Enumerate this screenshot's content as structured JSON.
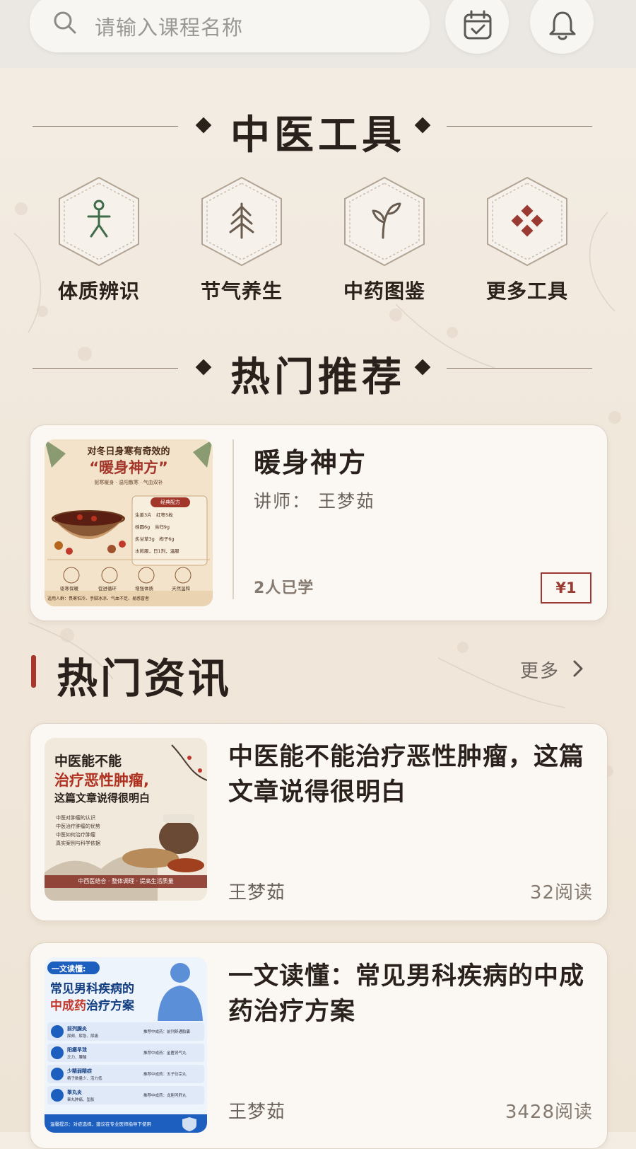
{
  "search": {
    "placeholder": "请输入课程名称",
    "icon": "search-icon"
  },
  "header_actions": [
    {
      "name": "calendar-icon"
    },
    {
      "name": "bell-icon"
    }
  ],
  "tools_section": {
    "title": "中医工具",
    "items": [
      {
        "label": "体质辨识",
        "icon": "person-icon",
        "color": "#3f6b4b"
      },
      {
        "label": "节气养生",
        "icon": "tree-icon",
        "color": "#6a5c4f"
      },
      {
        "label": "中药图鉴",
        "icon": "sprout-icon",
        "color": "#6a5c4f"
      },
      {
        "label": "更多工具",
        "icon": "diamonds-icon",
        "color": "#9b3a32"
      }
    ]
  },
  "recommend_section": {
    "title": "热门推荐",
    "course": {
      "title": "暖身神方",
      "teacher": "讲师： 王梦茹",
      "learners": "2人已学",
      "price": "¥1",
      "thumb": {
        "line1": "对冬日身寒有奇效的",
        "headline": "“暖身神方”",
        "sub": "驱寒暖身 · 温阳散寒 · 气血双补",
        "box_title": "经典配方",
        "box_lines": [
          "生姜3片　红枣5枚",
          "桂圆6g　当归9g",
          "炙甘草3g　枸子6g",
          "水煎服，日1剂，温服"
        ],
        "icons": [
          "驱寒保暖",
          "促进循环",
          "增强体质",
          "天然温和"
        ],
        "footer": "适用人群：畏寒怕冷、手脚冰凉、气血不足、易感冒者"
      }
    }
  },
  "news_section": {
    "title": "热门资讯",
    "more": "更多",
    "articles": [
      {
        "title": "中医能不能治疗恶性肿瘤，这篇文章说得很明白",
        "author": "王梦茹",
        "reads": "32阅读",
        "thumb": {
          "line1": "中医能不能",
          "line2": "治疗恶性肿瘤,",
          "line3": "这篇文章说得很明白",
          "bullets": [
            "中医对肿瘤的认识",
            "中医治疗肿瘤的优势",
            "中医如何治疗肿瘤",
            "真实案例与科学依据"
          ],
          "footer": "中西医结合 · 整体调理 · 提高生活质量"
        }
      },
      {
        "title": "一文读懂：常见男科疾病的中成药治疗方案",
        "author": "王梦茹",
        "reads": "3428阅读",
        "thumb": {
          "tag": "一文读懂:",
          "line1": "常见男科疾病的",
          "line2_red": "中成药",
          "line2_rest": "治疗方案",
          "rows": [
            {
              "name": "前列腺炎",
              "desc": "尿频、尿急、尿痛",
              "drug": "推荐中成药：前列舒通胶囊"
            },
            {
              "name": "阳痿早泄",
              "desc": "乏力、腰酸",
              "drug": "推荐中成药：金匮肾气丸"
            },
            {
              "name": "少精弱精症",
              "desc": "精子数量少、活力低",
              "drug": "推荐中成药：五子衍宗丸"
            },
            {
              "name": "睾丸炎",
              "desc": "睾丸肿痛、坠胀",
              "drug": "推荐中成药：龙胆泻肝丸"
            }
          ],
          "footer": "温馨提示：对症选择，建议在专业医师指导下使用"
        }
      }
    ]
  }
}
